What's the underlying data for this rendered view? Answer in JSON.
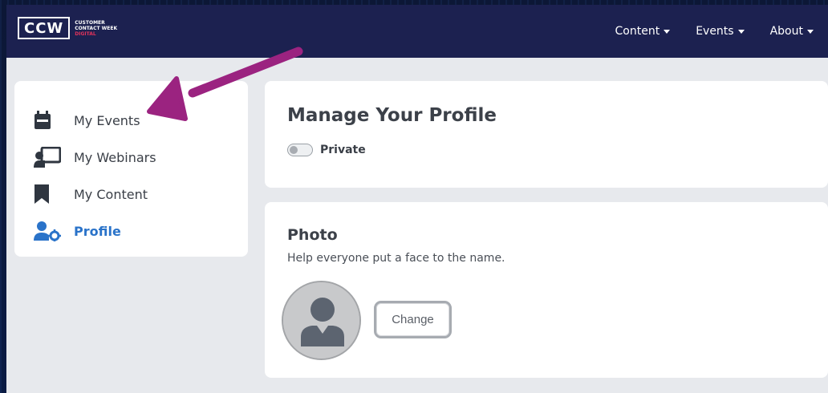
{
  "logo": {
    "main": "CCW",
    "line1": "CUSTOMER",
    "line2": "CONTACT WEEK",
    "line3": "DIGITAL"
  },
  "nav": [
    {
      "label": "Content"
    },
    {
      "label": "Events"
    },
    {
      "label": "About"
    }
  ],
  "sidebar": {
    "items": [
      {
        "label": "My Events",
        "icon": "calendar-icon"
      },
      {
        "label": "My Webinars",
        "icon": "presentation-icon"
      },
      {
        "label": "My Content",
        "icon": "bookmark-icon"
      },
      {
        "label": "Profile",
        "icon": "user-gear-icon",
        "active": true
      }
    ]
  },
  "profile": {
    "title": "Manage Your Profile",
    "privacy_label": "Private",
    "privacy_enabled": false
  },
  "photo": {
    "title": "Photo",
    "subtitle": "Help everyone put a face to the name.",
    "change_label": "Change"
  },
  "colors": {
    "navbar": "#1c2150",
    "accent": "#2a73c9",
    "annotation_arrow": "#9b2380"
  }
}
